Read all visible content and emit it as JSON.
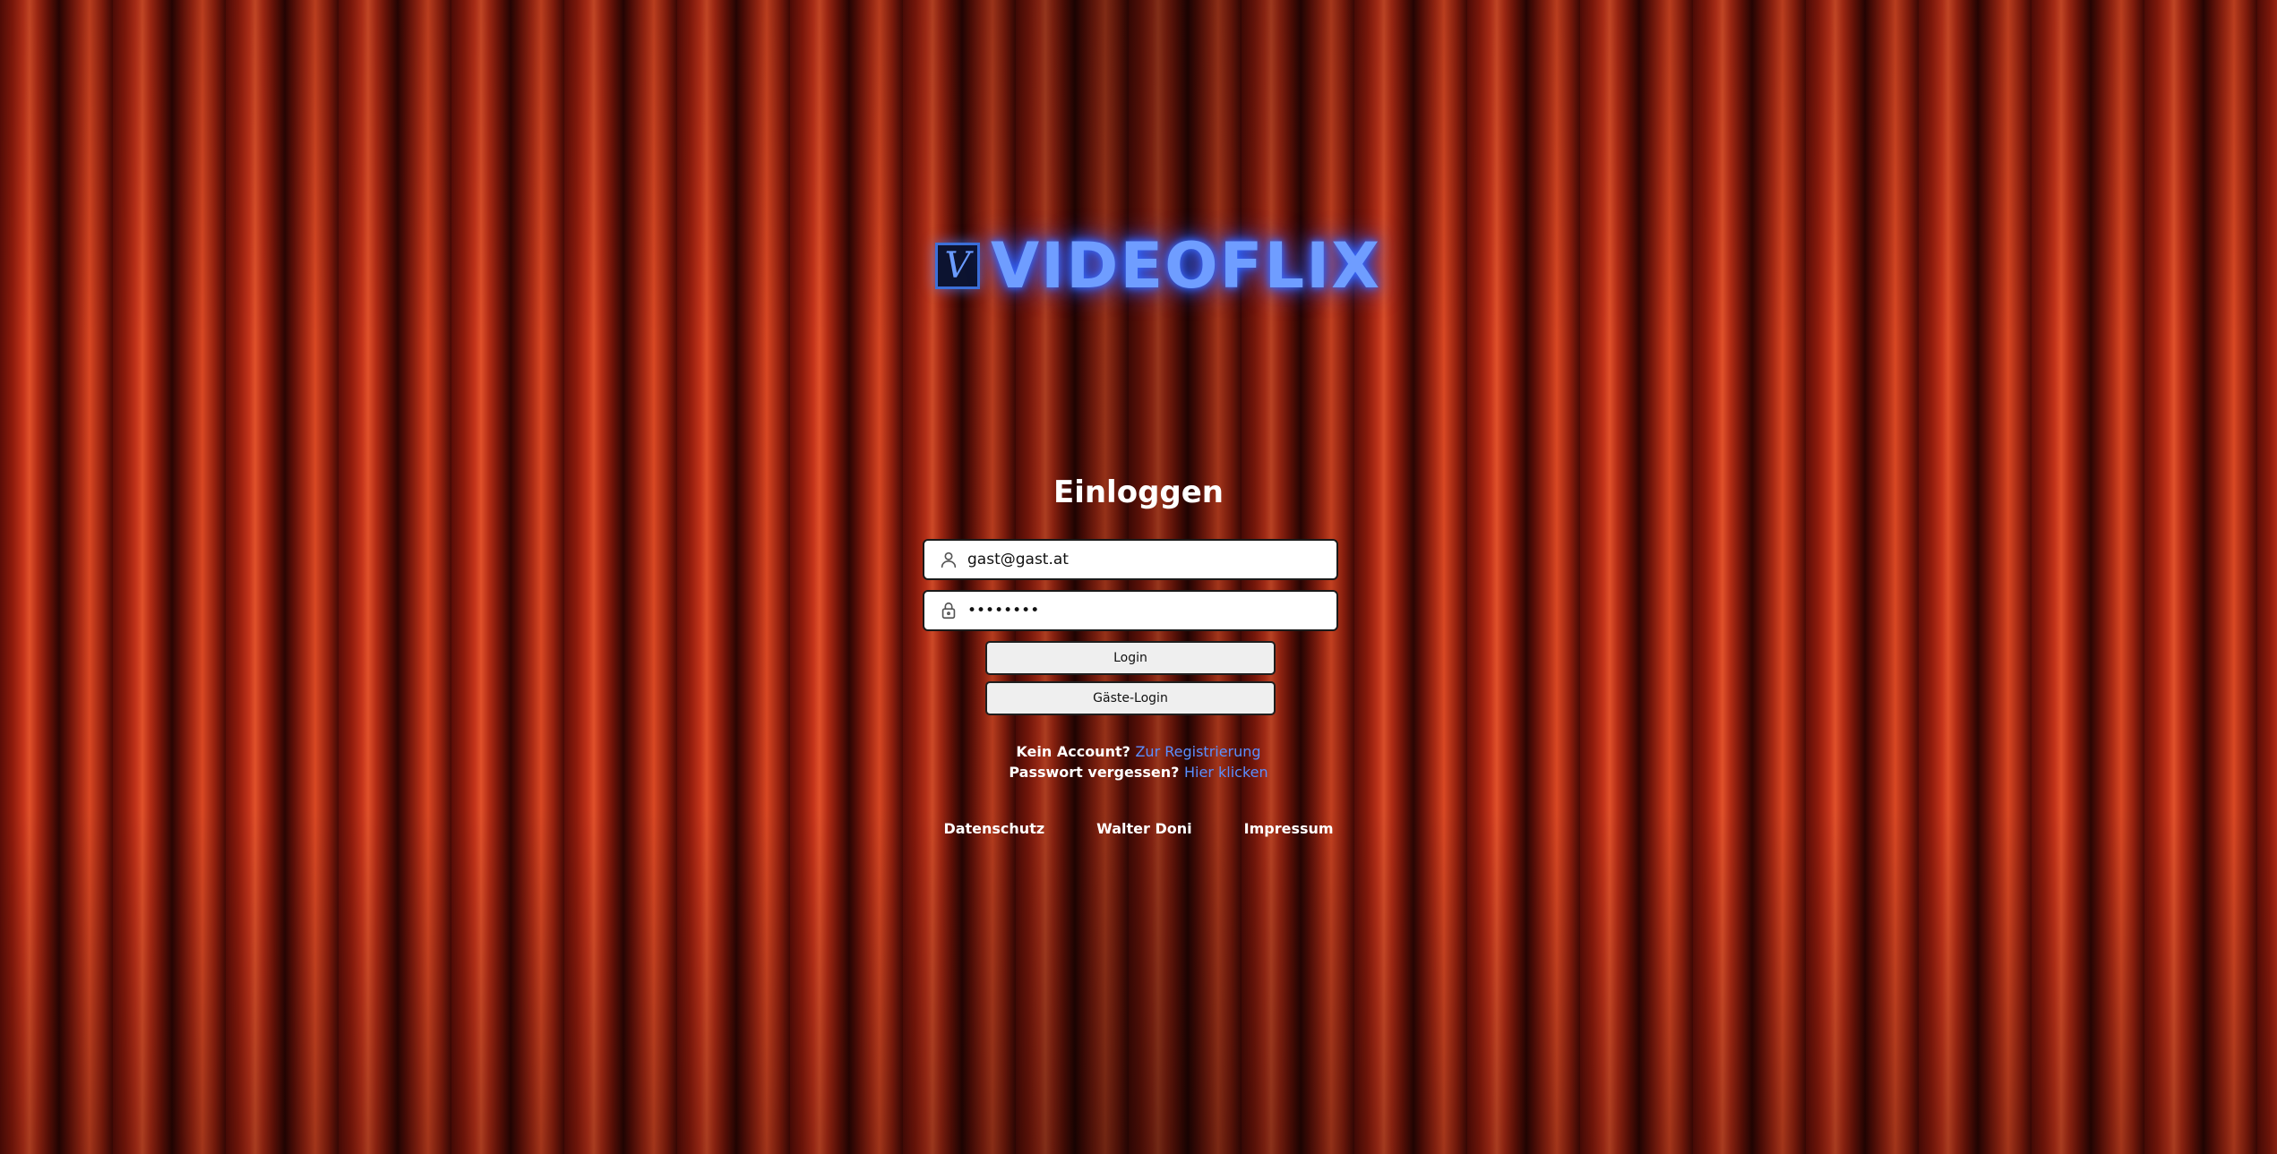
{
  "logo": {
    "mark": "V",
    "text": "VIDEOFLIX",
    "color": "#6f9dff"
  },
  "login": {
    "heading": "Einloggen",
    "email": {
      "value": "gast@gast.at",
      "icon": "user-icon"
    },
    "password": {
      "value": "••••••••",
      "icon": "lock-icon"
    },
    "login_button": "Login",
    "guest_button": "Gäste-Login"
  },
  "links": {
    "no_account_text": "Kein Account?",
    "register_link": "Zur Registrierung",
    "forgot_text": "Passwort vergessen?",
    "forgot_link": "Hier klicken",
    "link_color": "#5b8fff"
  },
  "footer": {
    "privacy": "Datenschutz",
    "author": "Walter Doni",
    "imprint": "Impressum"
  }
}
